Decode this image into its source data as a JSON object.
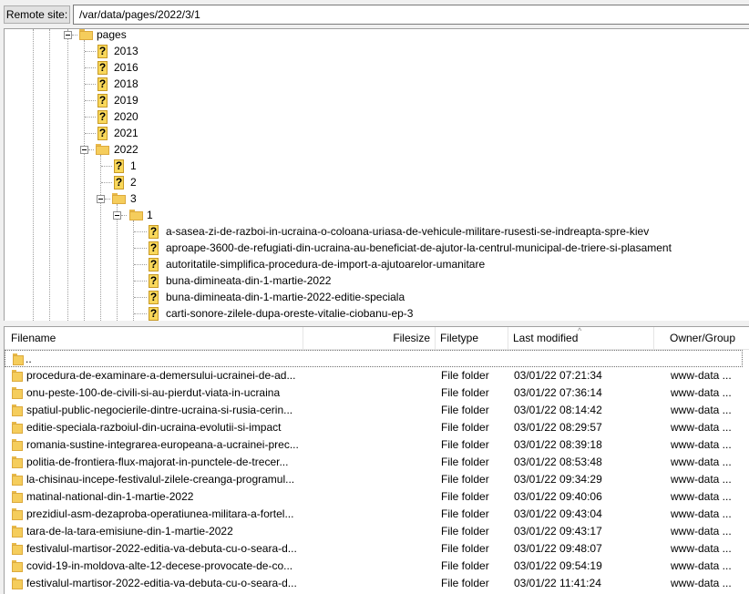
{
  "remote_site": {
    "label": "Remote site:",
    "path": "/var/data/pages/2022/3/1"
  },
  "tree": {
    "pages": "pages",
    "years": [
      "2013",
      "2016",
      "2018",
      "2019",
      "2020",
      "2021"
    ],
    "year_2022": "2022",
    "months": [
      "1",
      "2"
    ],
    "month_3": "3",
    "day_1": "1",
    "items": [
      "a-sasea-zi-de-razboi-in-ucraina-o-coloana-uriasa-de-vehicule-militare-rusesti-se-indreapta-spre-kiev",
      "aproape-3600-de-refugiati-din-ucraina-au-beneficiat-de-ajutor-la-centrul-municipal-de-triere-si-plasament",
      "autoritatile-simplifica-procedura-de-import-a-ajutoarelor-umanitare",
      "buna-dimineata-din-1-martie-2022",
      "buna-dimineata-din-1-martie-2022-editie-speciala",
      "carti-sonore-zilele-dupa-oreste-vitalie-ciobanu-ep-3"
    ],
    "unknown_glyph": "?"
  },
  "list": {
    "columns": {
      "filename": "Filename",
      "filesize": "Filesize",
      "filetype": "Filetype",
      "last_modified": "Last modified",
      "owner_group": "Owner/Group"
    },
    "sort_glyph": "^",
    "parent": "..",
    "rows": [
      {
        "name": "procedura-de-examinare-a-demersului-ucrainei-de-ad...",
        "type": "File folder",
        "modified": "03/01/22 07:21:34",
        "owner": "www-data ..."
      },
      {
        "name": "onu-peste-100-de-civili-si-au-pierdut-viata-in-ucraina",
        "type": "File folder",
        "modified": "03/01/22 07:36:14",
        "owner": "www-data ..."
      },
      {
        "name": "spatiul-public-negocierile-dintre-ucraina-si-rusia-cerin...",
        "type": "File folder",
        "modified": "03/01/22 08:14:42",
        "owner": "www-data ..."
      },
      {
        "name": "editie-speciala-razboiul-din-ucraina-evolutii-si-impact",
        "type": "File folder",
        "modified": "03/01/22 08:29:57",
        "owner": "www-data ..."
      },
      {
        "name": "romania-sustine-integrarea-europeana-a-ucrainei-prec...",
        "type": "File folder",
        "modified": "03/01/22 08:39:18",
        "owner": "www-data ..."
      },
      {
        "name": "politia-de-frontiera-flux-majorat-in-punctele-de-trecer...",
        "type": "File folder",
        "modified": "03/01/22 08:53:48",
        "owner": "www-data ..."
      },
      {
        "name": "la-chisinau-incepe-festivalul-zilele-creanga-programul...",
        "type": "File folder",
        "modified": "03/01/22 09:34:29",
        "owner": "www-data ..."
      },
      {
        "name": "matinal-national-din-1-martie-2022",
        "type": "File folder",
        "modified": "03/01/22 09:40:06",
        "owner": "www-data ..."
      },
      {
        "name": "prezidiul-asm-dezaproba-operatiunea-militara-a-fortel...",
        "type": "File folder",
        "modified": "03/01/22 09:43:04",
        "owner": "www-data ..."
      },
      {
        "name": "tara-de-la-tara-emisiune-din-1-martie-2022",
        "type": "File folder",
        "modified": "03/01/22 09:43:17",
        "owner": "www-data ..."
      },
      {
        "name": "festivalul-martisor-2022-editia-va-debuta-cu-o-seara-d...",
        "type": "File folder",
        "modified": "03/01/22 09:48:07",
        "owner": "www-data ..."
      },
      {
        "name": "covid-19-in-moldova-alte-12-decese-provocate-de-co...",
        "type": "File folder",
        "modified": "03/01/22 09:54:19",
        "owner": "www-data ..."
      },
      {
        "name": "festivalul-martisor-2022-editia-va-debuta-cu-o-seara-d...",
        "type": "File folder",
        "modified": "03/01/22 11:41:24",
        "owner": "www-data ..."
      }
    ]
  }
}
